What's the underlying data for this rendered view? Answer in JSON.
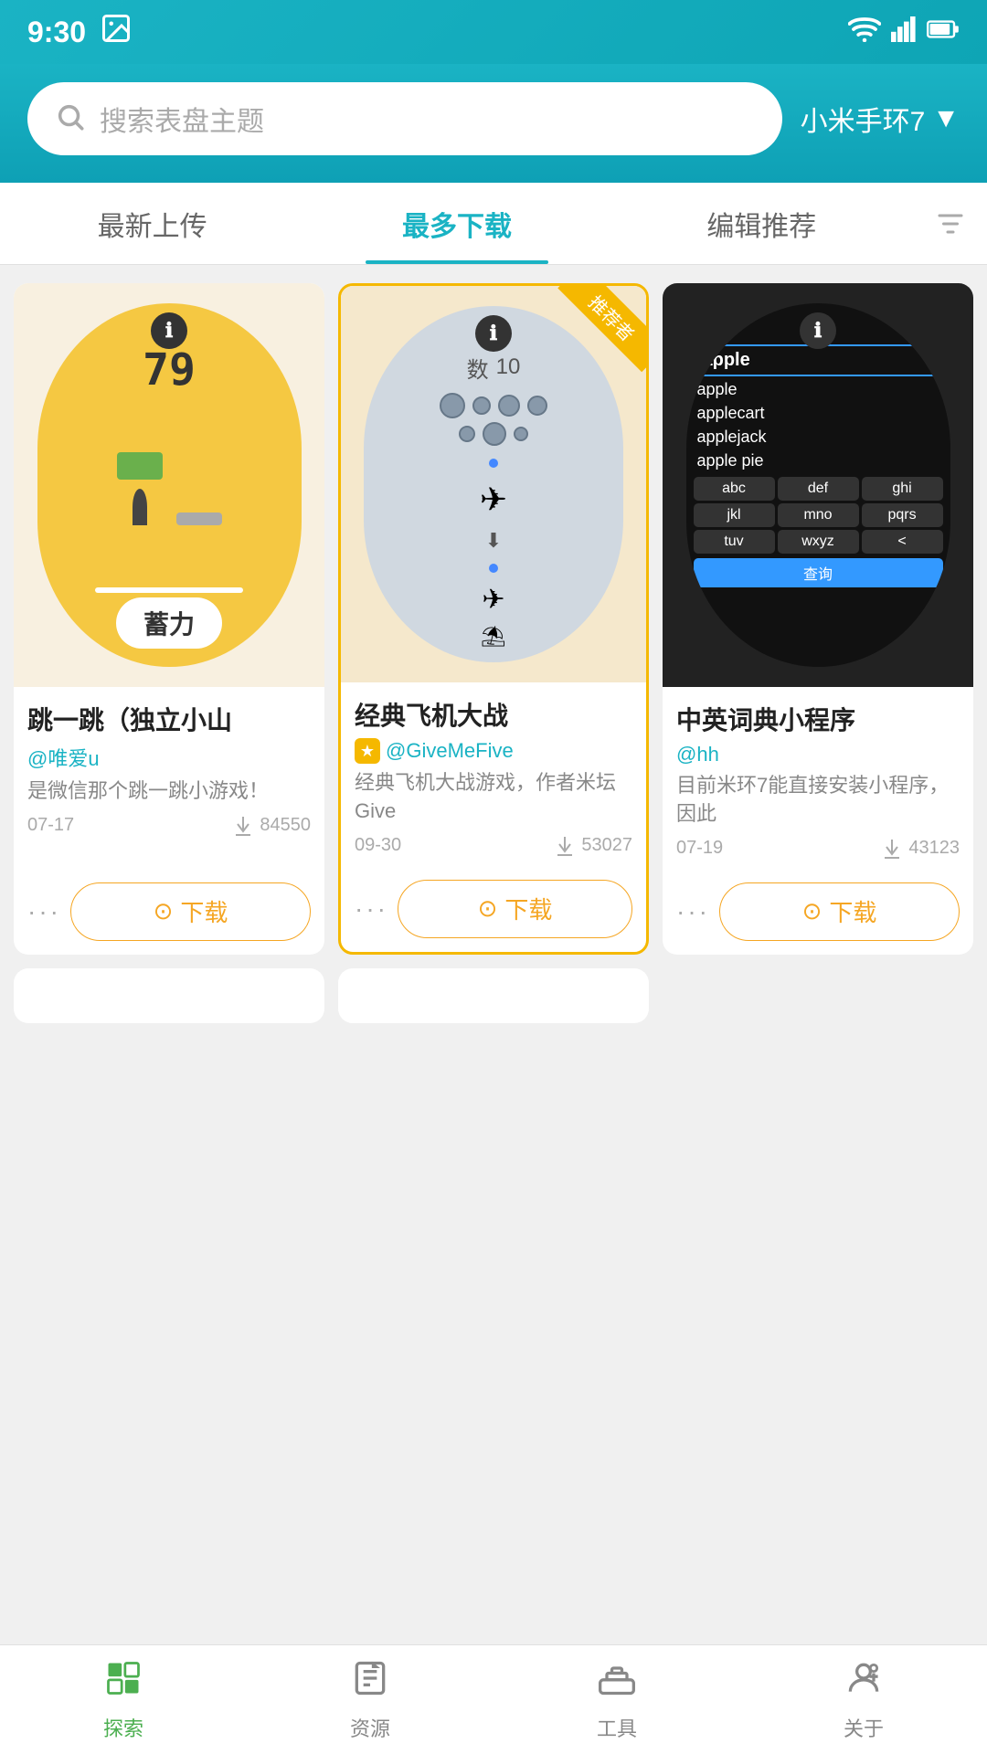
{
  "statusBar": {
    "time": "9:30",
    "wifiIcon": "wifi",
    "signalIcon": "signal",
    "batteryIcon": "battery"
  },
  "header": {
    "searchPlaceholder": "搜索表盘主题",
    "deviceLabel": "小米手环7",
    "deviceDropdown": "▼"
  },
  "tabs": {
    "items": [
      {
        "id": "newest",
        "label": "最新上传",
        "active": false
      },
      {
        "id": "mostDownloaded",
        "label": "最多下载",
        "active": true
      },
      {
        "id": "editorPick",
        "label": "编辑推荐",
        "active": false
      }
    ],
    "filterIcon": "filter"
  },
  "cards": [
    {
      "id": "card1",
      "title": "跳一跳（独立小山",
      "author": "@唯爱u",
      "description": "是微信那个跳一跳小游戏！",
      "date": "07-17",
      "downloads": "84550",
      "featured": false,
      "watchFaceType": "jump",
      "downloadLabel": "下载"
    },
    {
      "id": "card2",
      "title": "经典飞机大战",
      "author": "@GiveMeFive",
      "description": "经典飞机大战游戏，作者米坛Give",
      "date": "09-30",
      "downloads": "53027",
      "featured": true,
      "recommendLabel": "推荐者",
      "hasStar": true,
      "watchFaceType": "airplane",
      "downloadLabel": "下载"
    },
    {
      "id": "card3",
      "title": "中英词典小程序",
      "author": "@hh",
      "description": "目前米环7能直接安装小程序，因此",
      "date": "07-19",
      "downloads": "43123",
      "featured": false,
      "watchFaceType": "dictionary",
      "downloadLabel": "下载",
      "dictWords": [
        "apple",
        "apple",
        "applecart",
        "applejack",
        "apple pie"
      ],
      "dictKeys": [
        "abc",
        "def",
        "ghi",
        "jkl",
        "mno",
        "pqrs",
        "tuv",
        "wxyz",
        "<"
      ],
      "dictQueryLabel": "查询"
    }
  ],
  "bottomNav": {
    "items": [
      {
        "id": "explore",
        "label": "探索",
        "icon": "explore",
        "active": true
      },
      {
        "id": "resources",
        "label": "资源",
        "icon": "resources",
        "active": false
      },
      {
        "id": "tools",
        "label": "工具",
        "icon": "tools",
        "active": false
      },
      {
        "id": "about",
        "label": "关于",
        "icon": "about",
        "active": false
      }
    ]
  },
  "moreDotsLabel": "···",
  "downloadIconUnicode": "⊙"
}
